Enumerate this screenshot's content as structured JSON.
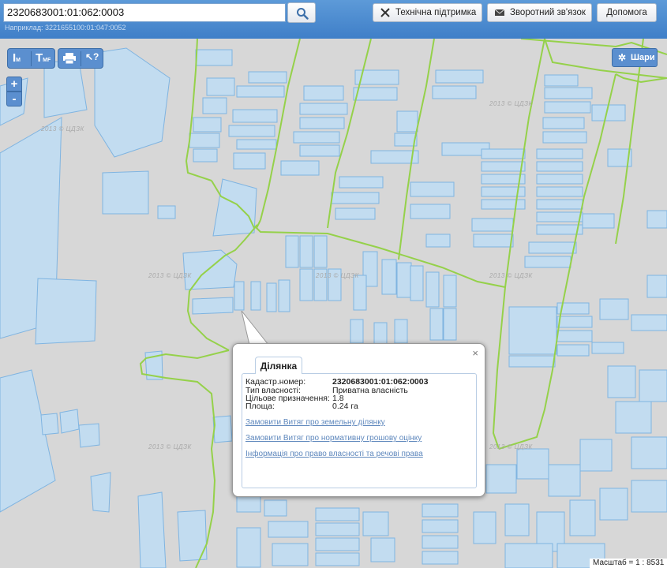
{
  "search": {
    "value": "2320683001:01:062:0003",
    "example": "Наприклад: 3221655100:01:047:0052"
  },
  "header_buttons": {
    "support": "Технічна підтримка",
    "feedback": "Зворотний зв'язок",
    "help": "Допомога"
  },
  "map_controls": {
    "zoom_in": "+",
    "zoom_out": "-",
    "layers": "Шари",
    "tool_icons": [
      "measure-length-icon",
      "measure-area-icon",
      "print-icon",
      "identify-cursor-icon"
    ]
  },
  "watermark_text": "2013 © ЦДЗК",
  "popup": {
    "tab": "Ділянка",
    "close": "×",
    "fields": [
      {
        "label": "Кадастр.номер:",
        "value": "2320683001:01:062:0003"
      },
      {
        "label": "Тип власності:",
        "value": "Приватна власність"
      },
      {
        "label": "Цільове призначення:",
        "value": "1.8"
      },
      {
        "label": "Площа:",
        "value": "0.24 га"
      }
    ],
    "links": [
      "Замовити Витяг про земельну ділянку",
      "Замовити Витяг про нормативну грошову оцінку",
      "Інформація про право власності та речові права"
    ]
  },
  "scale_text": "Масштаб = 1 : 8531",
  "colors": {
    "parcel_fill": "#c2dcf0",
    "parcel_stroke": "#7fb4e1",
    "boundary": "#95d14a",
    "header": "#4a88cf",
    "link": "#5f88bd"
  }
}
